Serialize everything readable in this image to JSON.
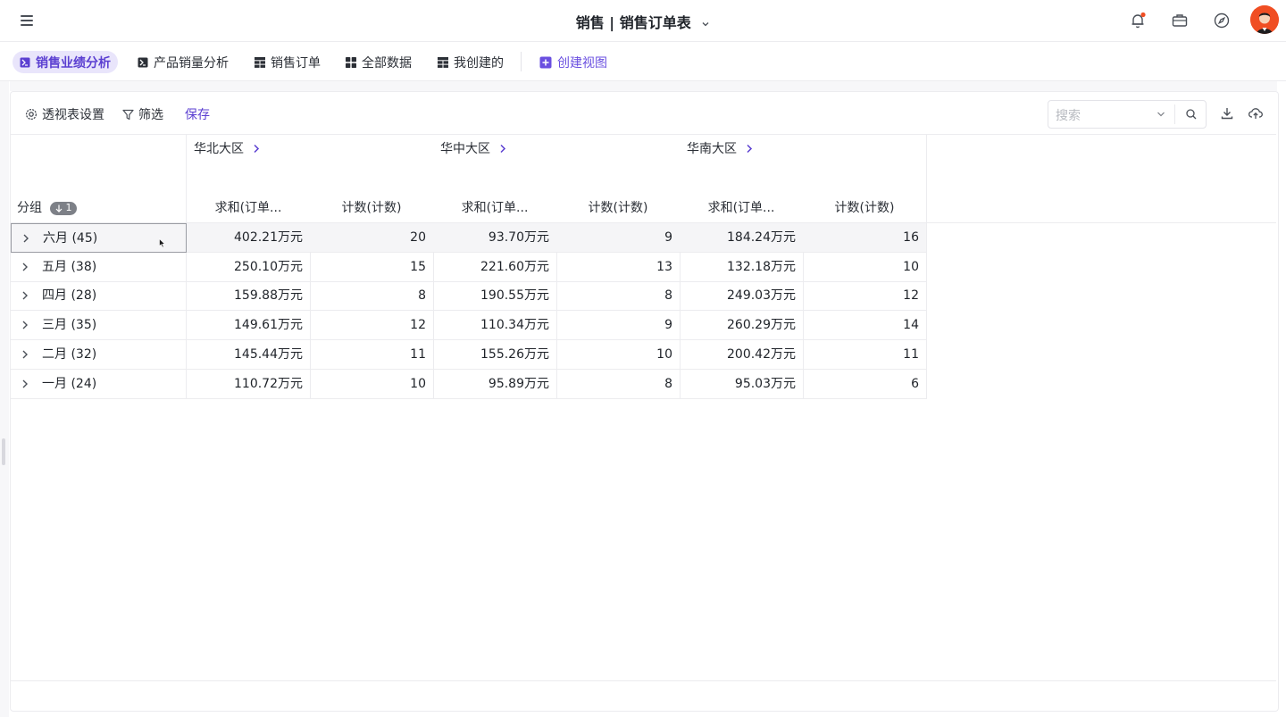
{
  "app": {
    "title": "销售 | 销售订单表",
    "icons": [
      "menu-icon",
      "bell-icon",
      "briefcase-icon",
      "compass-icon"
    ],
    "notification_dot_color": "#f04e23",
    "accent_color": "#5b3fd1"
  },
  "tabs": [
    {
      "label": "销售业绩分析",
      "icon": "pivot-icon",
      "active": true
    },
    {
      "label": "产品销量分析",
      "icon": "pivot-icon",
      "active": false
    },
    {
      "label": "销售订单",
      "icon": "grid-icon",
      "active": false
    },
    {
      "label": "全部数据",
      "icon": "kanban-icon",
      "active": false
    },
    {
      "label": "我创建的",
      "icon": "grid-icon",
      "active": false
    },
    {
      "label": "创建视图",
      "icon": "plus-square-icon",
      "active": false
    }
  ],
  "toolbar": {
    "pivot_settings": "透视表设置",
    "filter": "筛选",
    "save": "保存",
    "search_placeholder": "搜索"
  },
  "pivot": {
    "group_label": "分组",
    "sort_badge": "1",
    "regions": [
      "华北大区",
      "华中大区",
      "华南大区"
    ],
    "measures": [
      "求和(订单...",
      "计数(计数)"
    ],
    "rows": [
      {
        "label": "六月 (45)",
        "values": [
          "402.21万元",
          "20",
          "93.70万元",
          "9",
          "184.24万元",
          "16"
        ]
      },
      {
        "label": "五月 (38)",
        "values": [
          "250.10万元",
          "15",
          "221.60万元",
          "13",
          "132.18万元",
          "10"
        ]
      },
      {
        "label": "四月 (28)",
        "values": [
          "159.88万元",
          "8",
          "190.55万元",
          "8",
          "249.03万元",
          "12"
        ]
      },
      {
        "label": "三月 (35)",
        "values": [
          "149.61万元",
          "12",
          "110.34万元",
          "9",
          "260.29万元",
          "14"
        ]
      },
      {
        "label": "二月 (32)",
        "values": [
          "145.44万元",
          "11",
          "155.26万元",
          "10",
          "200.42万元",
          "11"
        ]
      },
      {
        "label": "一月 (24)",
        "values": [
          "110.72万元",
          "10",
          "95.89万元",
          "8",
          "95.03万元",
          "6"
        ]
      }
    ]
  }
}
